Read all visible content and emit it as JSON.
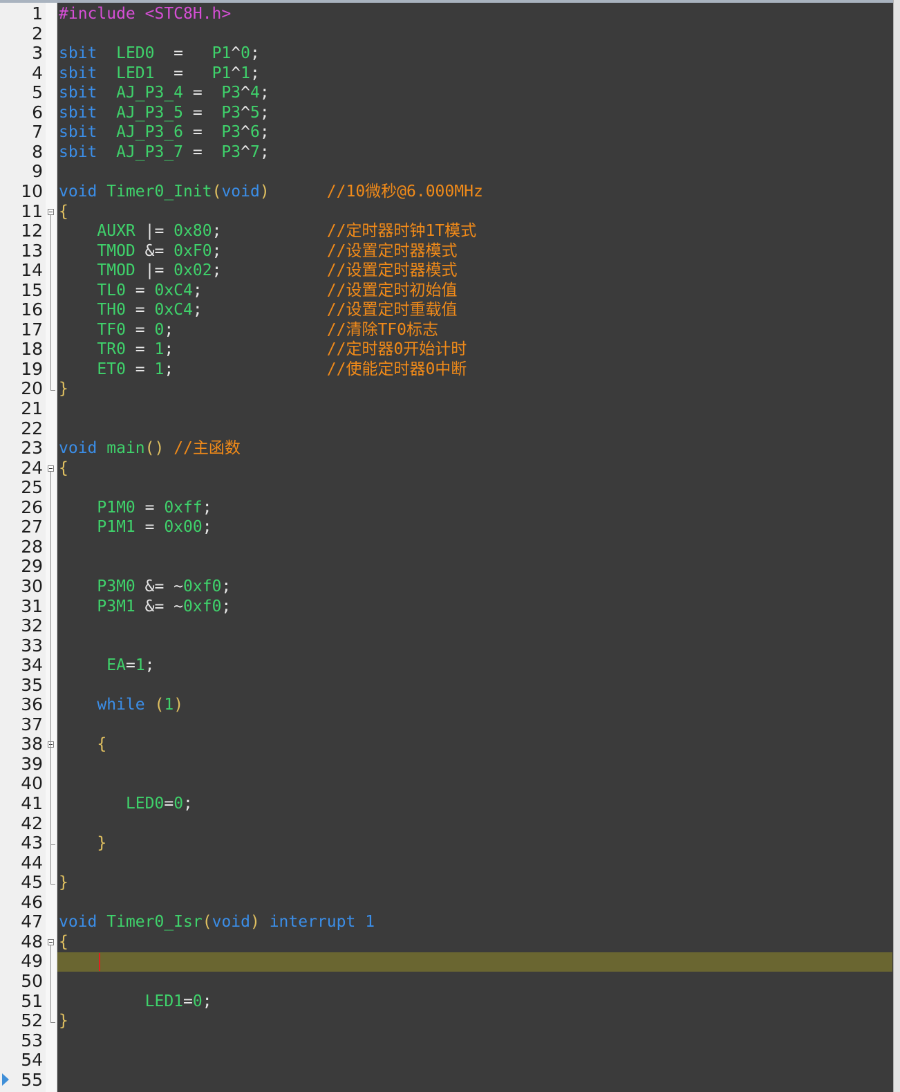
{
  "colors": {
    "background": "#3b3b3b",
    "current_line": "#6a6631",
    "keyword": "#3b8ee8",
    "identifier": "#3fd26b",
    "comment": "#f08a19",
    "preprocessor": "#d64fd6",
    "operator": "#e6e6e6"
  },
  "editor": {
    "current_line": 49,
    "fold_lines": [
      11,
      24,
      38,
      48
    ],
    "lines": [
      {
        "n": "1",
        "tokens": [
          [
            "pre",
            "#include "
          ],
          [
            "inc",
            "<STC8H.h>"
          ]
        ]
      },
      {
        "n": "2",
        "tokens": []
      },
      {
        "n": "3",
        "tokens": [
          [
            "kw",
            "sbit"
          ],
          [
            "op",
            "  "
          ],
          [
            "id",
            "LED0"
          ],
          [
            "op",
            "  =   "
          ],
          [
            "id",
            "P1"
          ],
          [
            "op",
            "^"
          ],
          [
            "num",
            "0"
          ],
          [
            "op",
            ";"
          ]
        ]
      },
      {
        "n": "4",
        "tokens": [
          [
            "kw",
            "sbit"
          ],
          [
            "op",
            "  "
          ],
          [
            "id",
            "LED1"
          ],
          [
            "op",
            "  =   "
          ],
          [
            "id",
            "P1"
          ],
          [
            "op",
            "^"
          ],
          [
            "num",
            "1"
          ],
          [
            "op",
            ";"
          ]
        ]
      },
      {
        "n": "5",
        "tokens": [
          [
            "kw",
            "sbit"
          ],
          [
            "op",
            "  "
          ],
          [
            "id",
            "AJ_P3_4"
          ],
          [
            "op",
            " =  "
          ],
          [
            "id",
            "P3"
          ],
          [
            "op",
            "^"
          ],
          [
            "num",
            "4"
          ],
          [
            "op",
            ";"
          ]
        ]
      },
      {
        "n": "6",
        "tokens": [
          [
            "kw",
            "sbit"
          ],
          [
            "op",
            "  "
          ],
          [
            "id",
            "AJ_P3_5"
          ],
          [
            "op",
            " =  "
          ],
          [
            "id",
            "P3"
          ],
          [
            "op",
            "^"
          ],
          [
            "num",
            "5"
          ],
          [
            "op",
            ";"
          ]
        ]
      },
      {
        "n": "7",
        "tokens": [
          [
            "kw",
            "sbit"
          ],
          [
            "op",
            "  "
          ],
          [
            "id",
            "AJ_P3_6"
          ],
          [
            "op",
            " =  "
          ],
          [
            "id",
            "P3"
          ],
          [
            "op",
            "^"
          ],
          [
            "num",
            "6"
          ],
          [
            "op",
            ";"
          ]
        ]
      },
      {
        "n": "8",
        "tokens": [
          [
            "kw",
            "sbit"
          ],
          [
            "op",
            "  "
          ],
          [
            "id",
            "AJ_P3_7"
          ],
          [
            "op",
            " =  "
          ],
          [
            "id",
            "P3"
          ],
          [
            "op",
            "^"
          ],
          [
            "num",
            "7"
          ],
          [
            "op",
            ";"
          ]
        ]
      },
      {
        "n": "9",
        "tokens": []
      },
      {
        "n": "10",
        "tokens": [
          [
            "kw",
            "void"
          ],
          [
            "op",
            " "
          ],
          [
            "fn",
            "Timer0_Init"
          ],
          [
            "br",
            "("
          ],
          [
            "kw",
            "void"
          ],
          [
            "br",
            ")"
          ],
          [
            "op",
            "      "
          ],
          [
            "cm",
            "//10微秒@6.000MHz"
          ]
        ]
      },
      {
        "n": "11",
        "tokens": [
          [
            "br",
            "{"
          ]
        ]
      },
      {
        "n": "12",
        "tokens": [
          [
            "op",
            "    "
          ],
          [
            "id",
            "AUXR"
          ],
          [
            "op",
            " |= "
          ],
          [
            "num",
            "0x80"
          ],
          [
            "op",
            ";"
          ],
          [
            "op",
            "           "
          ],
          [
            "cm",
            "//定时器时钟1T模式"
          ]
        ]
      },
      {
        "n": "13",
        "tokens": [
          [
            "op",
            "    "
          ],
          [
            "id",
            "TMOD"
          ],
          [
            "op",
            " &= "
          ],
          [
            "num",
            "0xF0"
          ],
          [
            "op",
            ";"
          ],
          [
            "op",
            "           "
          ],
          [
            "cm",
            "//设置定时器模式"
          ]
        ]
      },
      {
        "n": "14",
        "tokens": [
          [
            "op",
            "    "
          ],
          [
            "id",
            "TMOD"
          ],
          [
            "op",
            " |= "
          ],
          [
            "num",
            "0x02"
          ],
          [
            "op",
            ";"
          ],
          [
            "op",
            "           "
          ],
          [
            "cm",
            "//设置定时器模式"
          ]
        ]
      },
      {
        "n": "15",
        "tokens": [
          [
            "op",
            "    "
          ],
          [
            "id",
            "TL0"
          ],
          [
            "op",
            " = "
          ],
          [
            "num",
            "0xC4"
          ],
          [
            "op",
            ";"
          ],
          [
            "op",
            "             "
          ],
          [
            "cm",
            "//设置定时初始值"
          ]
        ]
      },
      {
        "n": "16",
        "tokens": [
          [
            "op",
            "    "
          ],
          [
            "id",
            "TH0"
          ],
          [
            "op",
            " = "
          ],
          [
            "num",
            "0xC4"
          ],
          [
            "op",
            ";"
          ],
          [
            "op",
            "             "
          ],
          [
            "cm",
            "//设置定时重载值"
          ]
        ]
      },
      {
        "n": "17",
        "tokens": [
          [
            "op",
            "    "
          ],
          [
            "id",
            "TF0"
          ],
          [
            "op",
            " = "
          ],
          [
            "num",
            "0"
          ],
          [
            "op",
            ";"
          ],
          [
            "op",
            "                "
          ],
          [
            "cm",
            "//清除TF0标志"
          ]
        ]
      },
      {
        "n": "18",
        "tokens": [
          [
            "op",
            "    "
          ],
          [
            "id",
            "TR0"
          ],
          [
            "op",
            " = "
          ],
          [
            "num",
            "1"
          ],
          [
            "op",
            ";"
          ],
          [
            "op",
            "                "
          ],
          [
            "cm",
            "//定时器0开始计时"
          ]
        ]
      },
      {
        "n": "19",
        "tokens": [
          [
            "op",
            "    "
          ],
          [
            "id",
            "ET0"
          ],
          [
            "op",
            " = "
          ],
          [
            "num",
            "1"
          ],
          [
            "op",
            ";"
          ],
          [
            "op",
            "                "
          ],
          [
            "cm",
            "//使能定时器0中断"
          ]
        ]
      },
      {
        "n": "20",
        "tokens": [
          [
            "br",
            "}"
          ]
        ]
      },
      {
        "n": "21",
        "tokens": []
      },
      {
        "n": "22",
        "tokens": []
      },
      {
        "n": "23",
        "tokens": [
          [
            "kw",
            "void"
          ],
          [
            "op",
            " "
          ],
          [
            "fn",
            "main"
          ],
          [
            "br",
            "()"
          ],
          [
            "op",
            " "
          ],
          [
            "cm",
            "//主函数"
          ]
        ]
      },
      {
        "n": "24",
        "tokens": [
          [
            "br",
            "{"
          ]
        ]
      },
      {
        "n": "25",
        "tokens": []
      },
      {
        "n": "26",
        "tokens": [
          [
            "op",
            "    "
          ],
          [
            "id",
            "P1M0"
          ],
          [
            "op",
            " = "
          ],
          [
            "num",
            "0xff"
          ],
          [
            "op",
            ";"
          ]
        ]
      },
      {
        "n": "27",
        "tokens": [
          [
            "op",
            "    "
          ],
          [
            "id",
            "P1M1"
          ],
          [
            "op",
            " = "
          ],
          [
            "num",
            "0x00"
          ],
          [
            "op",
            ";"
          ]
        ]
      },
      {
        "n": "28",
        "tokens": []
      },
      {
        "n": "29",
        "tokens": []
      },
      {
        "n": "30",
        "tokens": [
          [
            "op",
            "    "
          ],
          [
            "id",
            "P3M0"
          ],
          [
            "op",
            " &= ~"
          ],
          [
            "num",
            "0xf0"
          ],
          [
            "op",
            ";"
          ]
        ]
      },
      {
        "n": "31",
        "tokens": [
          [
            "op",
            "    "
          ],
          [
            "id",
            "P3M1"
          ],
          [
            "op",
            " &= ~"
          ],
          [
            "num",
            "0xf0"
          ],
          [
            "op",
            ";"
          ]
        ]
      },
      {
        "n": "32",
        "tokens": []
      },
      {
        "n": "33",
        "tokens": []
      },
      {
        "n": "34",
        "tokens": [
          [
            "op",
            "     "
          ],
          [
            "id",
            "EA"
          ],
          [
            "op",
            "="
          ],
          [
            "num",
            "1"
          ],
          [
            "op",
            ";"
          ]
        ]
      },
      {
        "n": "35",
        "tokens": []
      },
      {
        "n": "36",
        "tokens": [
          [
            "op",
            "    "
          ],
          [
            "kw",
            "while"
          ],
          [
            "op",
            " "
          ],
          [
            "br",
            "("
          ],
          [
            "num",
            "1"
          ],
          [
            "br",
            ")"
          ]
        ]
      },
      {
        "n": "37",
        "tokens": []
      },
      {
        "n": "38",
        "tokens": [
          [
            "op",
            "    "
          ],
          [
            "br",
            "{"
          ]
        ]
      },
      {
        "n": "39",
        "tokens": []
      },
      {
        "n": "40",
        "tokens": []
      },
      {
        "n": "41",
        "tokens": [
          [
            "op",
            "       "
          ],
          [
            "id",
            "LED0"
          ],
          [
            "op",
            "="
          ],
          [
            "num",
            "0"
          ],
          [
            "op",
            ";"
          ]
        ]
      },
      {
        "n": "42",
        "tokens": []
      },
      {
        "n": "43",
        "tokens": [
          [
            "op",
            "    "
          ],
          [
            "br",
            "}"
          ]
        ]
      },
      {
        "n": "44",
        "tokens": []
      },
      {
        "n": "45",
        "tokens": [
          [
            "br",
            "}"
          ]
        ]
      },
      {
        "n": "46",
        "tokens": []
      },
      {
        "n": "47",
        "tokens": [
          [
            "kw",
            "void"
          ],
          [
            "op",
            " "
          ],
          [
            "fn",
            "Timer0_Isr"
          ],
          [
            "br",
            "("
          ],
          [
            "kw",
            "void"
          ],
          [
            "br",
            ")"
          ],
          [
            "op",
            " "
          ],
          [
            "kw",
            "interrupt"
          ],
          [
            "op",
            " "
          ],
          [
            "kw",
            "1"
          ]
        ]
      },
      {
        "n": "48",
        "tokens": [
          [
            "br",
            "{"
          ]
        ]
      },
      {
        "n": "49",
        "tokens": []
      },
      {
        "n": "50",
        "tokens": []
      },
      {
        "n": "51",
        "tokens": [
          [
            "op",
            "         "
          ],
          [
            "id",
            "LED1"
          ],
          [
            "op",
            "="
          ],
          [
            "num",
            "0"
          ],
          [
            "op",
            ";"
          ]
        ]
      },
      {
        "n": "52",
        "tokens": [
          [
            "br",
            "}"
          ]
        ]
      },
      {
        "n": "53",
        "tokens": []
      },
      {
        "n": "54",
        "tokens": []
      },
      {
        "n": "55",
        "tokens": []
      }
    ]
  }
}
